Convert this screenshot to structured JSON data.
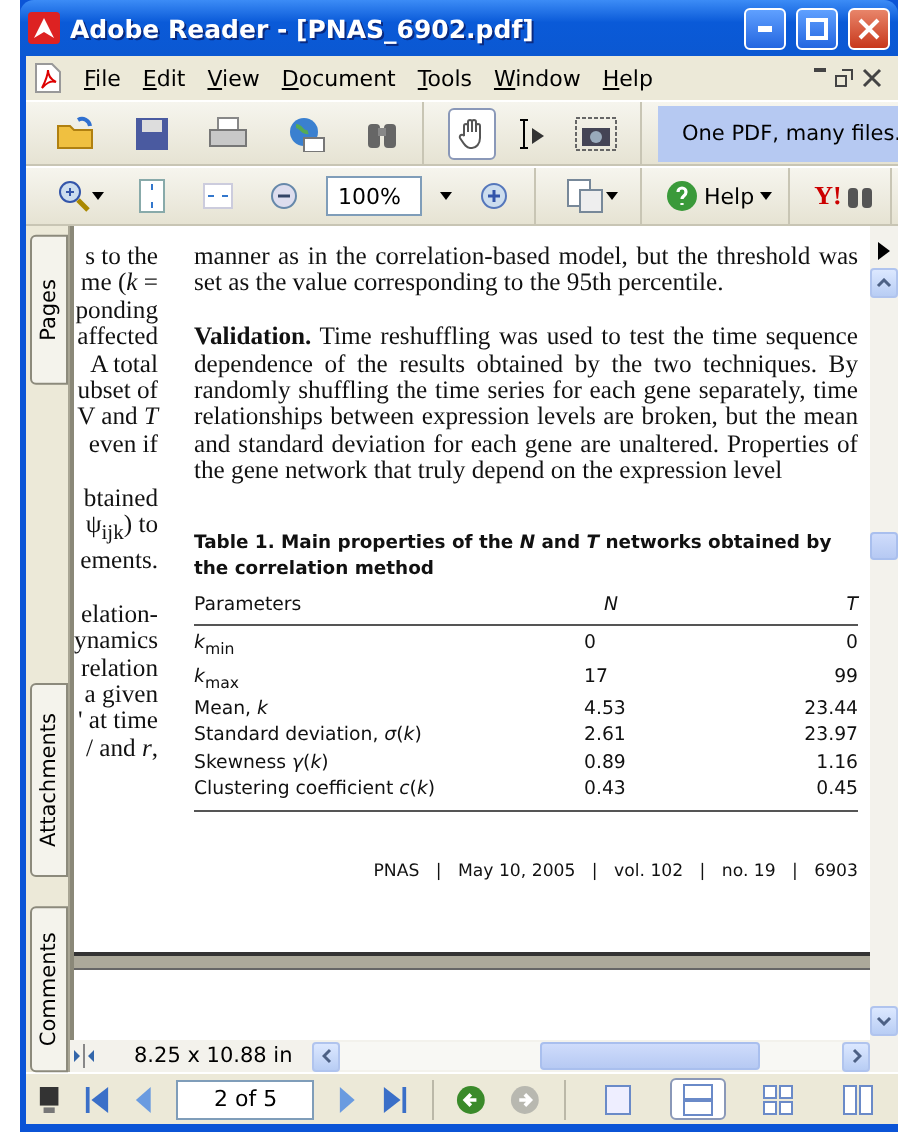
{
  "window": {
    "title": "Adobe Reader - [PNAS_6902.pdf]"
  },
  "menu": [
    "File",
    "Edit",
    "View",
    "Document",
    "Tools",
    "Window",
    "Help"
  ],
  "tools": [
    {
      "kind": "hand",
      "selected": true
    },
    {
      "kind": "select",
      "selected": false
    },
    {
      "kind": "snapshot",
      "selected": false
    }
  ],
  "promo": {
    "label": "One PDF, many files."
  },
  "zoom": {
    "value": "100%"
  },
  "help": {
    "label": "Help"
  },
  "search_logo": {
    "label": "Y!"
  },
  "sidebar_tabs": [
    {
      "label": "Pages"
    },
    {
      "label": "Attachments"
    },
    {
      "label": "Comments"
    }
  ],
  "document": {
    "left_column": [
      [
        "s to the",
        "me (*k* =",
        "ponding",
        "affected",
        "A total",
        "ubset of",
        "V and *T*",
        "even if"
      ],
      [
        "btained",
        "ψ$_{ijk}$) to",
        "ements."
      ],
      [
        "elation-",
        "ynamics",
        "relation",
        "a given",
        "' at time",
        "/ and *r*,"
      ]
    ],
    "paragraphs": [
      "manner as in the correlation-based model, but the threshold was set as the value corresponding to the 95th percentile.",
      "**Validation.** Time reshuffling was used to test the time sequence dependence of the results obtained by the two techniques. By randomly shuffling the time series for each gene separately, time relationships between expression levels are broken, but the mean and standard deviation for each gene are unaltered. Properties of the gene network that truly depend on the expression level"
    ],
    "table": {
      "title": "Table 1. Main properties of the *N* and *T* networks obtained by the correlation method",
      "columns": [
        "Parameters",
        "N",
        "T"
      ],
      "rows": [
        [
          "*k*$_{min}$",
          "0",
          "0"
        ],
        [
          "*k*$_{max}$",
          "17",
          "99"
        ],
        [
          "Mean, *k*",
          "4.53",
          "23.44"
        ],
        [
          "Standard deviation, *σ*(*k*)",
          "2.61",
          "23.97"
        ],
        [
          "Skewness *γ*(*k*)",
          "0.89",
          "1.16"
        ],
        [
          "Clustering coefficient *c*(*k*)",
          "0.43",
          "0.45"
        ]
      ]
    },
    "footer": "PNAS   |   May 10, 2005   |   vol. 102   |   no. 19   |   6903"
  },
  "status": {
    "page_size": "8.25 x 10.88 in"
  },
  "navigation": {
    "page": "2 of 5",
    "back_enabled": true,
    "forward_enabled": false
  },
  "views": [
    {
      "kind": "single",
      "selected": false
    },
    {
      "kind": "continuous",
      "selected": true
    },
    {
      "kind": "continuous_facing",
      "selected": false
    },
    {
      "kind": "facing",
      "selected": false
    }
  ]
}
